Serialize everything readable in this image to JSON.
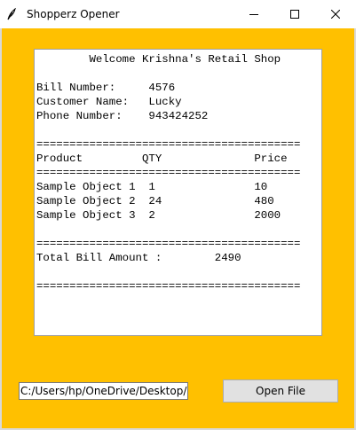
{
  "window": {
    "title": "Shopperz Opener",
    "icon": "feather-icon",
    "controls": [
      "minimize-icon",
      "maximize-icon",
      "close-icon"
    ]
  },
  "receipt": {
    "text": "        Welcome Krishna's Retail Shop\n\nBill Number:     4576\nCustomer Name:   Lucky\nPhone Number:    943424252\n\n========================================\nProduct         QTY              Price\n========================================\nSample Object 1  1               10\nSample Object 2  24              480\nSample Object 3  2               2000\n\n========================================\nTotal Bill Amount :        2490\n\n========================================"
  },
  "path_field": {
    "value": "C:/Users/hp/OneDrive/Desktop/Ow"
  },
  "open_button": {
    "label": "Open File"
  },
  "colors": {
    "background": "#ffc000",
    "receipt_background": "#ffffff",
    "button_face": "#e1e1e1"
  }
}
